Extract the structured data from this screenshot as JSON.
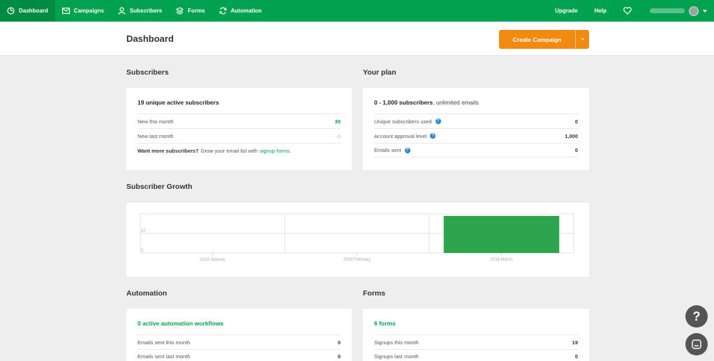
{
  "nav": {
    "items": [
      {
        "label": "Dashboard",
        "icon": "dashboard-icon"
      },
      {
        "label": "Campaigns",
        "icon": "envelope-icon"
      },
      {
        "label": "Subscribers",
        "icon": "user-icon"
      },
      {
        "label": "Forms",
        "icon": "layers-icon"
      },
      {
        "label": "Automation",
        "icon": "refresh-icon"
      }
    ],
    "upgrade": "Upgrade",
    "help": "Help"
  },
  "header": {
    "title": "Dashboard",
    "create_campaign": "Create Campaign"
  },
  "subscribers": {
    "section_title": "Subscribers",
    "headline": "19 unique active subscribers",
    "rows": [
      {
        "label": "New this month",
        "value": "30"
      },
      {
        "label": "New last month",
        "value": "0"
      }
    ],
    "note_bold": "Want more subscribers?",
    "note_text": "Grow your email list with",
    "note_link": "signup forms",
    "note_end": "."
  },
  "plan": {
    "section_title": "Your plan",
    "headline_bold": "0 - 1,000 subscribers",
    "headline_rest": ", unlimited emails",
    "rows": [
      {
        "label": "Unique subscribers used",
        "value": "0"
      },
      {
        "label": "Account approval level",
        "value": "1,000"
      },
      {
        "label": "Emails sent",
        "value": "0"
      }
    ]
  },
  "growth": {
    "section_title": "Subscriber Growth"
  },
  "chart_data": {
    "type": "bar",
    "categories": [
      "2018 January",
      "2018 February",
      "2018 March"
    ],
    "values": [
      0,
      0,
      19
    ],
    "ylim": [
      0,
      20
    ],
    "yticks": [
      0,
      10
    ],
    "grid": true,
    "color": "#2da44e"
  },
  "automation": {
    "section_title": "Automation",
    "headline": "0 active automation workflows",
    "rows": [
      {
        "label": "Emails sent this month",
        "value": "0"
      },
      {
        "label": "Emails sent last month",
        "value": "0"
      }
    ]
  },
  "forms": {
    "section_title": "Forms",
    "headline": "6 forms",
    "rows": [
      {
        "label": "Signups this month",
        "value": "19"
      },
      {
        "label": "Signups last month",
        "value": "0"
      }
    ]
  },
  "float": {
    "help_glyph": "?"
  },
  "colors": {
    "brand_green": "#00a24f",
    "accent_orange": "#f28a12"
  }
}
